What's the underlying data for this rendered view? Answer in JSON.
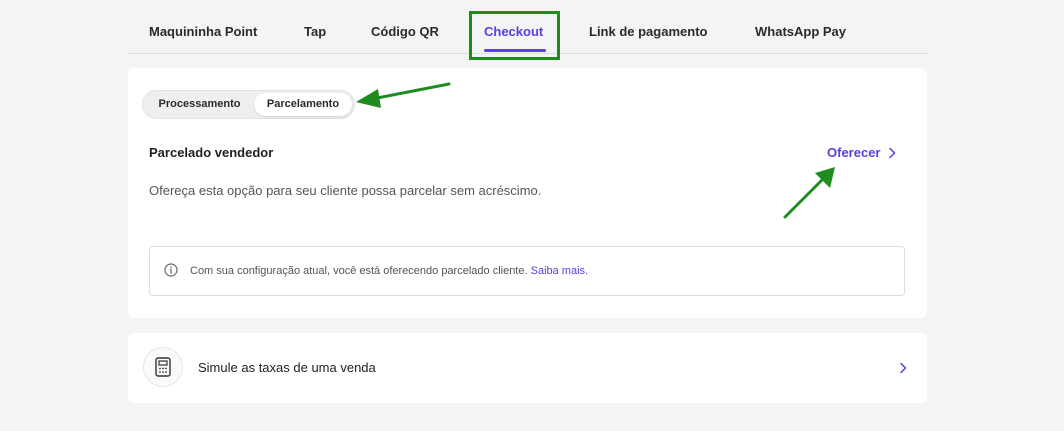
{
  "tabs": [
    {
      "label": "Maquininha Point"
    },
    {
      "label": "Tap"
    },
    {
      "label": "Código QR"
    },
    {
      "label": "Checkout",
      "active": true
    },
    {
      "label": "Link de pagamento"
    },
    {
      "label": "WhatsApp Pay"
    }
  ],
  "segmented": {
    "options": [
      "Processamento",
      "Parcelamento"
    ],
    "selected": "Parcelamento"
  },
  "section": {
    "title": "Parcelado vendedor",
    "action_label": "Oferecer",
    "description": "Ofereça esta opção para seu cliente possa parcelar sem acréscimo."
  },
  "info": {
    "text": "Com sua configuração atual, você está oferecendo parcelado cliente.",
    "link": "Saiba mais."
  },
  "simulate": {
    "label": "Simule as taxas de uma venda"
  },
  "colors": {
    "accent": "#5b3de6",
    "annotation": "#1e8c1e",
    "background": "#f4f4f4"
  }
}
